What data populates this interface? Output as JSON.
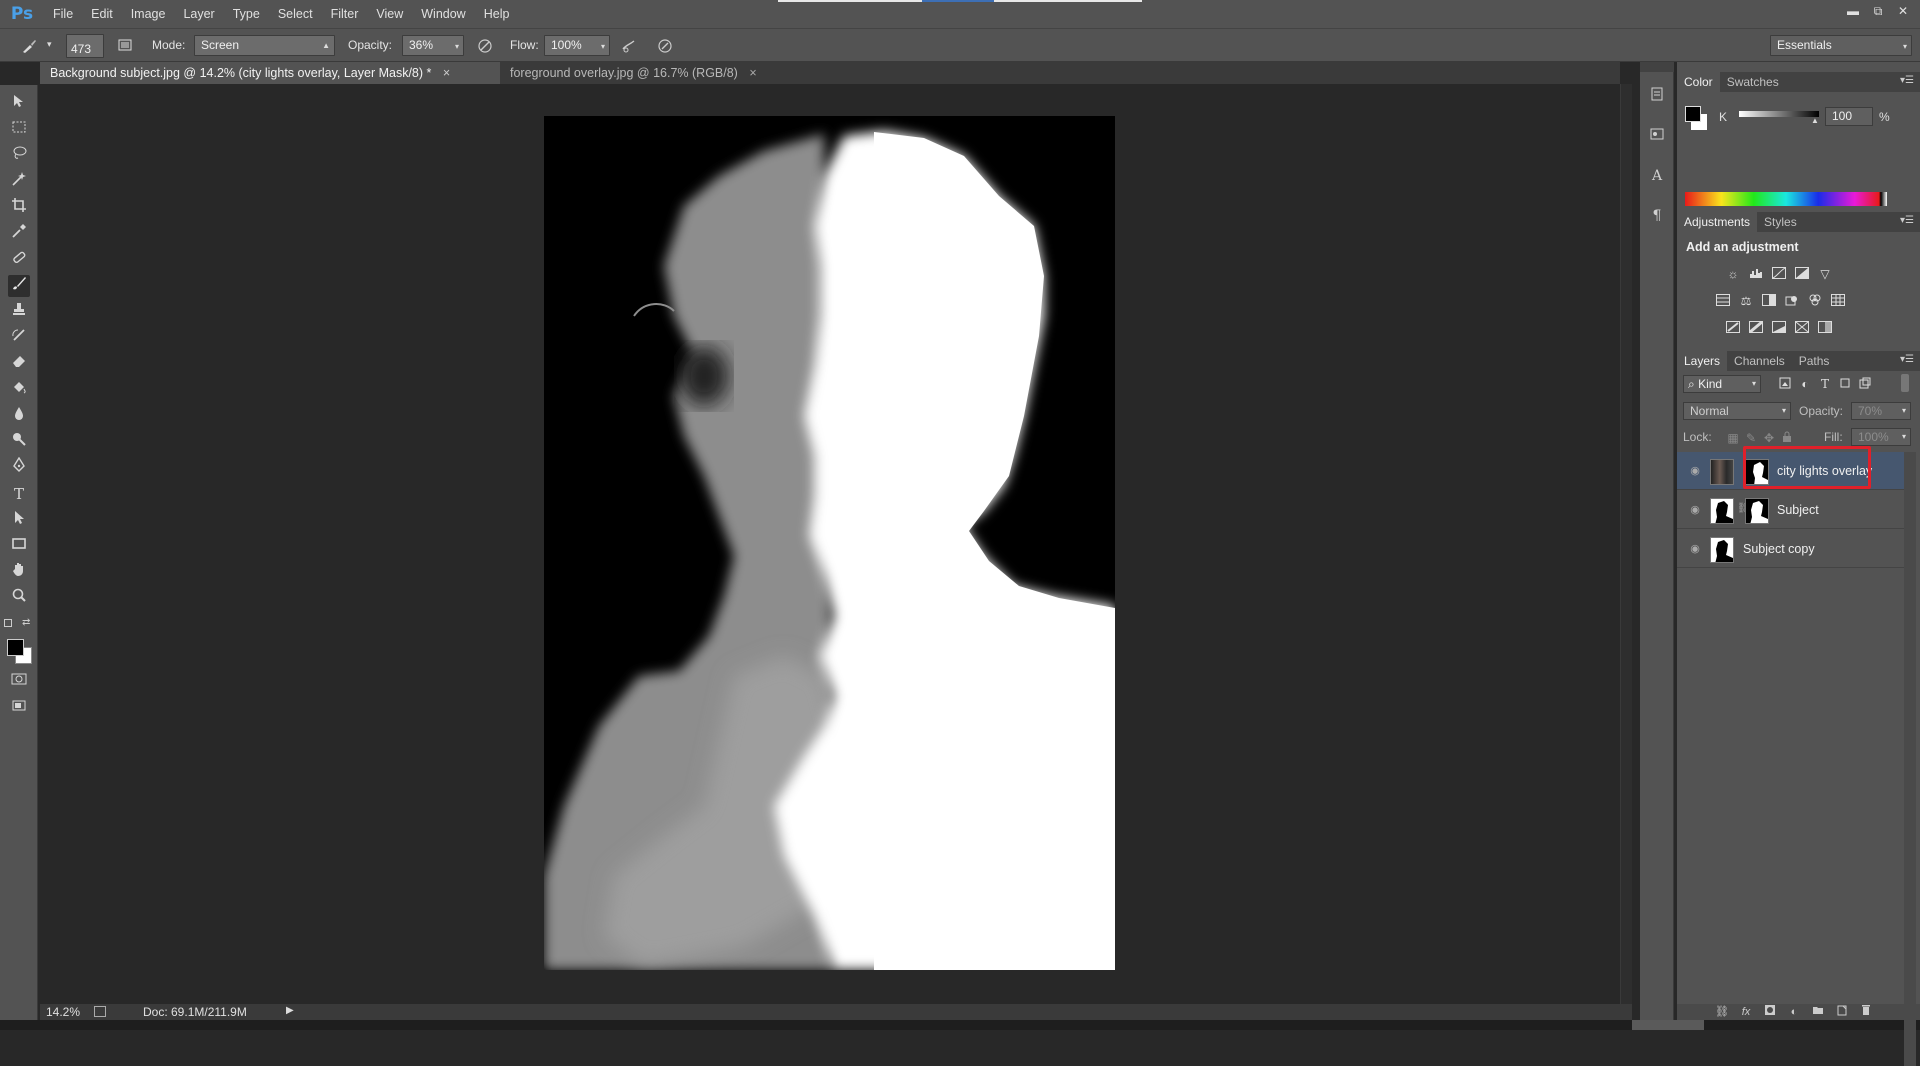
{
  "app": {
    "logo": "Ps"
  },
  "menu": [
    "File",
    "Edit",
    "Image",
    "Layer",
    "Type",
    "Select",
    "Filter",
    "View",
    "Window",
    "Help"
  ],
  "window_controls": {
    "minimize": "▬",
    "restore": "⧉",
    "close": "✕"
  },
  "options": {
    "brush_size": "473",
    "mode_label": "Mode:",
    "mode_value": "Screen",
    "opacity_label": "Opacity:",
    "opacity_value": "36%",
    "flow_label": "Flow:",
    "flow_value": "100%",
    "workspace": "Essentials"
  },
  "tabs": [
    {
      "label": "Background subject.jpg @ 14.2% (city lights overlay, Layer Mask/8) *",
      "active": true,
      "close": "×"
    },
    {
      "label": "foreground overlay.jpg @ 16.7% (RGB/8)",
      "active": false,
      "close": "×"
    }
  ],
  "tools": [
    "move-tool-icon",
    "marquee-tool-icon",
    "lasso-tool-icon",
    "magic-wand-icon",
    "crop-tool-icon",
    "eyedropper-icon",
    "healing-brush-icon",
    "brush-tool-icon",
    "clone-stamp-icon",
    "history-brush-icon",
    "eraser-icon",
    "paint-bucket-icon",
    "blur-tool-icon",
    "dodge-tool-icon",
    "pen-tool-icon",
    "type-tool-icon",
    "path-selection-icon",
    "shape-tool-icon",
    "hand-tool-icon",
    "zoom-tool-icon"
  ],
  "status": {
    "zoom": "14.2%",
    "doc": "Doc: 69.1M/211.9M"
  },
  "color_panel": {
    "tabs": [
      "Color",
      "Swatches"
    ],
    "channel": "K",
    "value": "100",
    "unit": "%"
  },
  "adjustments_panel": {
    "tabs": [
      "Adjustments",
      "Styles"
    ],
    "heading": "Add an adjustment"
  },
  "layers_panel": {
    "tabs": [
      "Layers",
      "Channels",
      "Paths"
    ],
    "filter": "Kind",
    "blend_mode": "Normal",
    "opacity_label": "Opacity:",
    "opacity_value": "70%",
    "lock_label": "Lock:",
    "fill_label": "Fill:",
    "fill_value": "100%",
    "layers": [
      {
        "name": "city lights overlay",
        "selected": true,
        "has_mask": true
      },
      {
        "name": "Subject",
        "selected": false,
        "has_mask": true
      },
      {
        "name": "Subject copy",
        "selected": false,
        "has_mask": false
      }
    ]
  },
  "colors": {
    "highlight_box": "#e0202a",
    "selected_layer": "#46576f",
    "ps_blue": "#4aa0e8"
  }
}
